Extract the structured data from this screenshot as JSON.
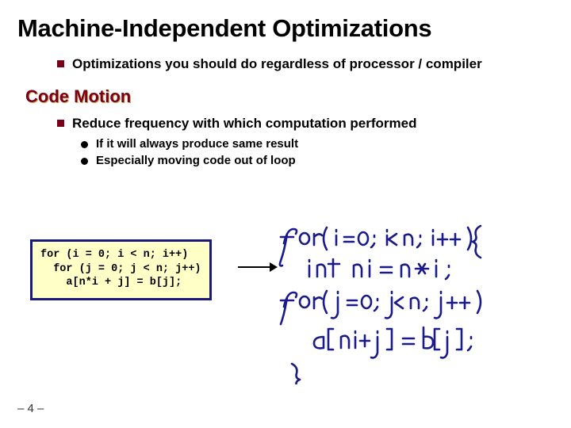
{
  "title": "Machine-Independent Optimizations",
  "bullet1": "Optimizations you should do regardless of processor / compiler",
  "section": "Code Motion",
  "bullet2": "Reduce frequency with which computation performed",
  "sub1": "If it will always produce same result",
  "sub2": "Especially moving code out of loop",
  "code": {
    "l1": "for (i = 0; i < n; i++)",
    "l2": "  for (j = 0; j < n; j++)",
    "l3": "    a[n*i + j] = b[j];"
  },
  "handwritten": {
    "l1": "for(i=0; i<n; i++){",
    "l2": "  int ni = n*i;",
    "l3": "  for(j=0; j<n; j++)",
    "l4": "    a[ni+j] = b[j];",
    "l5": "}"
  },
  "page": "– 4 –"
}
